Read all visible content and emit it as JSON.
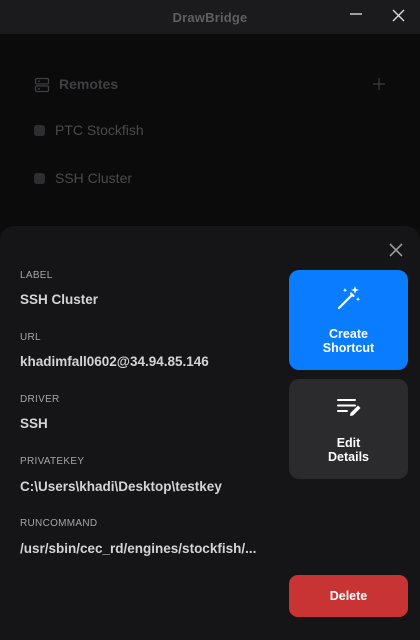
{
  "window": {
    "title": "DrawBridge",
    "minimize_icon": "minimize-icon",
    "close_icon": "close-icon"
  },
  "sidebar": {
    "header_label": "Remotes",
    "header_icon": "server-icon",
    "add_icon": "plus-icon",
    "items": [
      {
        "label": "PTC Stockfish"
      },
      {
        "label": "SSH Cluster"
      }
    ]
  },
  "details": {
    "fields": [
      {
        "label": "LABEL",
        "value": "SSH Cluster"
      },
      {
        "label": "URL",
        "value": "khadimfall0602@34.94.85.146"
      },
      {
        "label": "DRIVER",
        "value": "SSH"
      },
      {
        "label": "PRIVATEKEY",
        "value": "C:\\Users\\khadi\\Desktop\\testkey"
      },
      {
        "label": "RUNCOMMAND",
        "value": "/usr/sbin/cec_rd/engines/stockfish/..."
      }
    ],
    "close_icon": "close-icon"
  },
  "actions": {
    "create_shortcut": {
      "line1": "Create",
      "line2": "Shortcut",
      "icon": "magic-wand-icon"
    },
    "edit_details": {
      "line1": "Edit",
      "line2": "Details",
      "icon": "edit-list-icon"
    },
    "delete": {
      "label": "Delete"
    }
  },
  "colors": {
    "accent": "#0a7cff",
    "danger": "#c83434",
    "sheet": "#151517",
    "background": "#0b0b0c"
  }
}
